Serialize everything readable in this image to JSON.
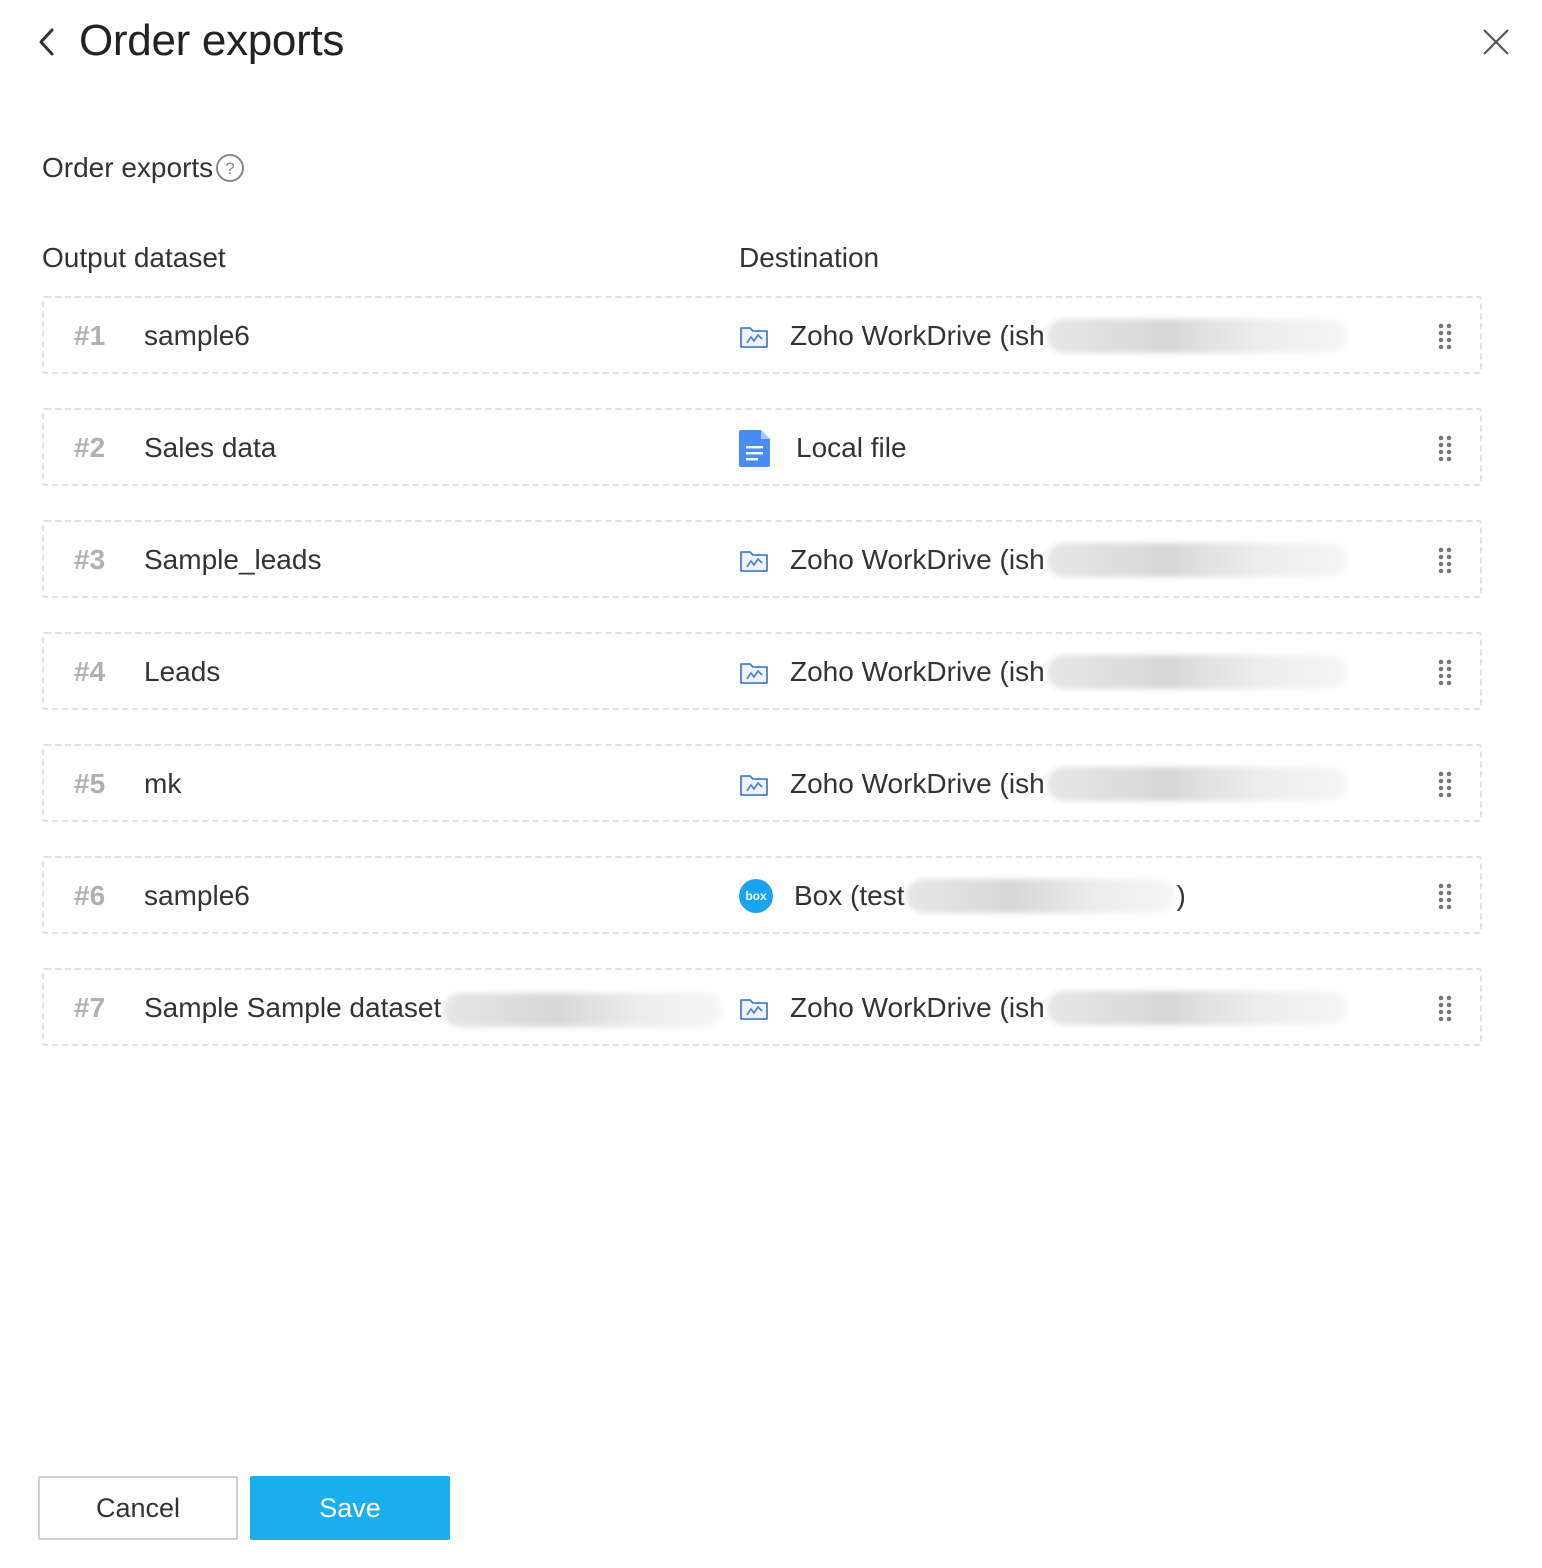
{
  "header": {
    "title": "Order exports"
  },
  "section": {
    "title": "Order exports"
  },
  "columns": {
    "output": "Output dataset",
    "destination": "Destination"
  },
  "rows": [
    {
      "num": "#1",
      "name": "sample6",
      "dest_icon": "workdrive-folder-icon",
      "dest": "Zoho WorkDrive (ish",
      "dest_suffix": ""
    },
    {
      "num": "#2",
      "name": "Sales data",
      "dest_icon": "local-file-icon",
      "dest": "Local file",
      "dest_suffix": ""
    },
    {
      "num": "#3",
      "name": "Sample_leads",
      "dest_icon": "workdrive-folder-icon",
      "dest": "Zoho WorkDrive (ish",
      "dest_suffix": ""
    },
    {
      "num": "#4",
      "name": "Leads",
      "dest_icon": "workdrive-folder-icon",
      "dest": "Zoho WorkDrive (ish",
      "dest_suffix": ""
    },
    {
      "num": "#5",
      "name": "mk",
      "dest_icon": "workdrive-folder-icon",
      "dest": "Zoho WorkDrive (ish",
      "dest_suffix": ""
    },
    {
      "num": "#6",
      "name": "sample6",
      "dest_icon": "box-icon",
      "dest": "Box (test",
      "dest_suffix": ")"
    },
    {
      "num": "#7",
      "name": "Sample Sample dataset",
      "dest_icon": "workdrive-folder-icon",
      "dest": "Zoho WorkDrive (ish",
      "dest_suffix": ""
    }
  ],
  "footer": {
    "cancel_label": "Cancel",
    "save_label": "Save"
  },
  "colors": {
    "accent": "#1aafec",
    "row_number": "#b0b0b0",
    "border": "#e2e2e2"
  }
}
